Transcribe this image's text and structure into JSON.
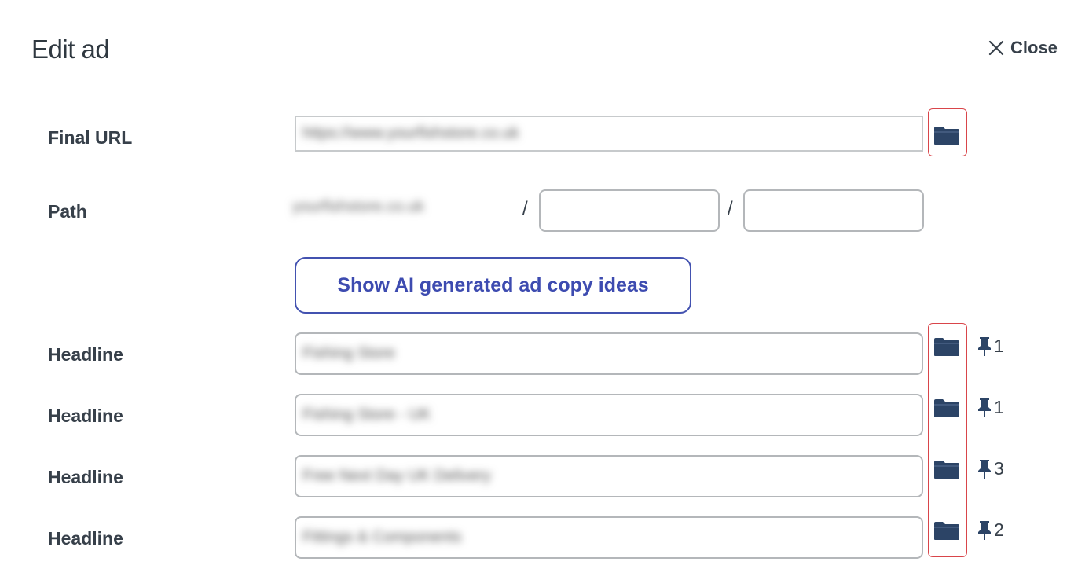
{
  "dialog": {
    "title": "Edit ad",
    "close_label": "Close"
  },
  "final_url": {
    "label": "Final URL",
    "value": "https://www.yourfishstore.co.uk"
  },
  "path": {
    "label": "Path",
    "domain": "yourfishstore.co.uk",
    "separator": "/",
    "path1": "",
    "path2": ""
  },
  "ai_button": {
    "label": "Show AI generated ad copy ideas"
  },
  "headlines": [
    {
      "label": "Headline",
      "value": "Fishing Store",
      "pin": "1"
    },
    {
      "label": "Headline",
      "value": "Fishing Store - UK",
      "pin": "1"
    },
    {
      "label": "Headline",
      "value": "Free Next Day UK Delivery",
      "pin": "3"
    },
    {
      "label": "Headline",
      "value": "Fittings & Components",
      "pin": "2"
    }
  ],
  "colors": {
    "accent": "#3d4bb0",
    "folder_icon": "#2c4466",
    "highlight_border": "#d9454a",
    "text": "#37404a"
  },
  "icons": {
    "close": "close-x-icon",
    "folder": "folder-icon",
    "pin": "pushpin-icon"
  }
}
